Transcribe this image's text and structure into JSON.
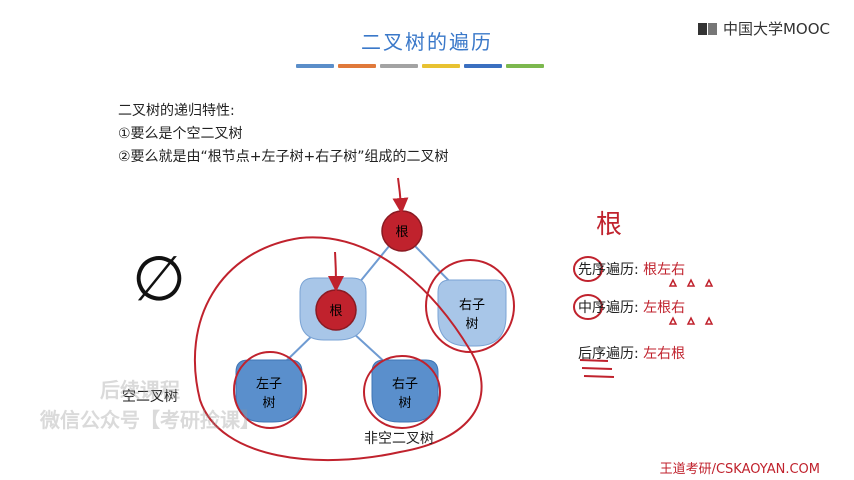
{
  "header": {
    "title": "二叉树的遍历",
    "logo": "中国大学MOOC"
  },
  "accent_colors": [
    "#5b8ec9",
    "#e0793a",
    "#a3a3a3",
    "#e8c231",
    "#3a6fc0",
    "#7cb84e"
  ],
  "intro": {
    "line1": "二叉树的递归特性:",
    "line2": "①要么是个空二叉树",
    "line3": "②要么就是由“根节点+左子树+右子树”组成的二叉树"
  },
  "empty_symbol": "∅",
  "tree": {
    "root": "根",
    "sub_root": "根",
    "left_top_line1": "左子",
    "left_top_line2": "树",
    "right_top_line1": "右子",
    "right_top_line2": "树",
    "left_bottom_line1": "左子",
    "left_bottom_line2": "树",
    "right_bottom_line1": "右子",
    "right_bottom_line2": "树"
  },
  "labels": {
    "empty_tree": "空二叉树",
    "nonempty_tree": "非空二叉树"
  },
  "traversals": [
    {
      "name": "先序遍历:",
      "order": "根左右"
    },
    {
      "name": "中序遍历:",
      "order": "左根右"
    },
    {
      "name": "后序遍历:",
      "order": "左右根"
    }
  ],
  "annotation_root": "根",
  "watermark": {
    "line1": "后续课程",
    "line2": "微信公众号【考研捡课】"
  },
  "footer": "王道考研/CSKAOYAN.COM"
}
